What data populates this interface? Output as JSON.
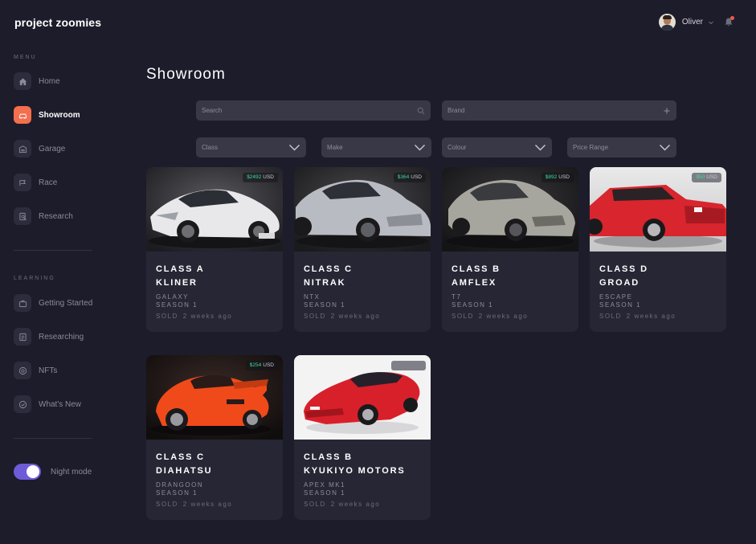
{
  "app": {
    "title": "project zoomies"
  },
  "sidebar": {
    "menu_label": "MENU",
    "learning_label": "LEARNING",
    "menu_items": [
      {
        "label": "Home",
        "icon": "home-icon"
      },
      {
        "label": "Showroom",
        "icon": "car-icon",
        "active": true
      },
      {
        "label": "Garage",
        "icon": "garage-icon"
      },
      {
        "label": "Race",
        "icon": "race-icon"
      },
      {
        "label": "Research",
        "icon": "research-icon"
      }
    ],
    "learning_items": [
      {
        "label": "Getting Started",
        "icon": "briefcase-icon"
      },
      {
        "label": "Researching",
        "icon": "document-icon"
      },
      {
        "label": "NFTs",
        "icon": "coin-icon"
      },
      {
        "label": "What's New",
        "icon": "check-badge-icon"
      }
    ],
    "night_mode": {
      "label": "Night mode",
      "on": true
    }
  },
  "header": {
    "user_name": "Oliver"
  },
  "main": {
    "title": "Showroom",
    "search": {
      "placeholder": "Search"
    },
    "brand": {
      "placeholder": "Brand"
    },
    "filters": [
      {
        "label": "Class"
      },
      {
        "label": "Make"
      },
      {
        "label": "Colour"
      },
      {
        "label": "Price Range"
      }
    ],
    "cards": [
      {
        "price": "$2492",
        "currency": "USD",
        "class_label": "CLASS A",
        "name": "KLINER",
        "model": "GALAXY",
        "season": "SEASON 1",
        "sold": "SOLD",
        "time": "2 weeks ago",
        "car_color": "#e8e8ea"
      },
      {
        "price": "$364",
        "currency": "USD",
        "class_label": "CLASS C",
        "name": "NITRAK",
        "model": "NTX",
        "season": "SEASON 1",
        "sold": "SOLD",
        "time": "2 weeks ago",
        "car_color": "#b9bbc2"
      },
      {
        "price": "$892",
        "currency": "USD",
        "class_label": "CLASS B",
        "name": "AMFLEX",
        "model": "T7",
        "season": "SEASON 1",
        "sold": "SOLD",
        "time": "2 weeks ago",
        "car_color": "#a7a69e"
      },
      {
        "price": "$50",
        "currency": "USD",
        "class_label": "CLASS D",
        "name": "GROAD",
        "model": "ESCAPE",
        "season": "SEASON 1",
        "sold": "SOLD",
        "time": "2 weeks ago",
        "car_color": "#d8252e"
      },
      {
        "price": "$254",
        "currency": "USD",
        "class_label": "CLASS C",
        "name": "DIAHATSU",
        "model": "DRANGOON",
        "season": "SEASON 1",
        "sold": "SOLD",
        "time": "2 weeks ago",
        "car_color": "#f04a1a"
      },
      {
        "price": "",
        "currency": "",
        "class_label": "CLASS B",
        "name": "KYUKIYO MOTORS",
        "model": "APEX MK1",
        "season": "SEASON 1",
        "sold": "SOLD",
        "time": "2 weeks ago",
        "car_color": "#d8202a"
      }
    ]
  },
  "colors": {
    "background": "#1d1c2a",
    "card": "#262635",
    "accent": "#f36f4d",
    "toggle": "#6e5bd8",
    "price_green": "#3ddc97"
  }
}
